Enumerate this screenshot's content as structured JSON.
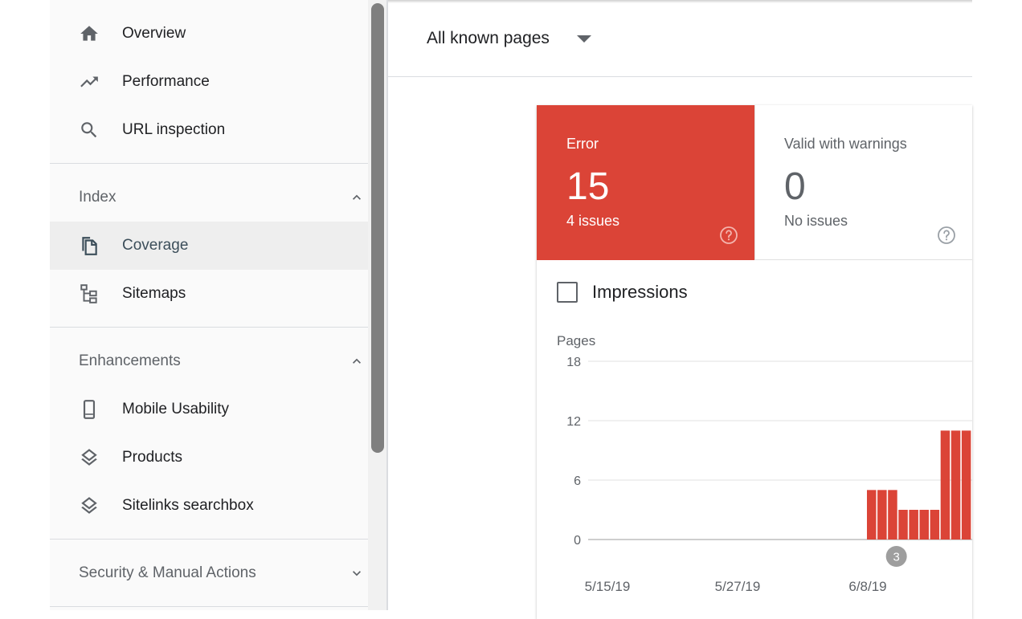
{
  "sidebar": {
    "top_items": [
      {
        "label": "Overview",
        "icon": "home-icon"
      },
      {
        "label": "Performance",
        "icon": "trending-up-icon"
      },
      {
        "label": "URL inspection",
        "icon": "search-icon"
      }
    ],
    "index_section": {
      "label": "Index",
      "expanded": true,
      "items": [
        {
          "label": "Coverage",
          "icon": "coverage-icon",
          "active": true
        },
        {
          "label": "Sitemaps",
          "icon": "sitemap-icon"
        }
      ]
    },
    "enhancements_section": {
      "label": "Enhancements",
      "expanded": true,
      "items": [
        {
          "label": "Mobile Usability",
          "icon": "smartphone-icon"
        },
        {
          "label": "Products",
          "icon": "layers-icon"
        },
        {
          "label": "Sitelinks searchbox",
          "icon": "layers-icon"
        }
      ]
    },
    "security_section": {
      "label": "Security & Manual Actions",
      "expanded": false
    }
  },
  "main": {
    "filter": {
      "label": "All known pages"
    },
    "tiles": {
      "error": {
        "title": "Error",
        "value": "15",
        "sub": "4 issues",
        "color": "#db4437"
      },
      "warnings": {
        "title": "Valid with warnings",
        "value": "0",
        "sub": "No issues"
      }
    },
    "impressions_label": "Impressions",
    "impressions_checked": false
  },
  "chart_data": {
    "type": "bar",
    "ylabel": "Pages",
    "ylim": [
      0,
      18
    ],
    "yticks": [
      "18",
      "12",
      "6",
      "0"
    ],
    "xticks": [
      "5/15/19",
      "5/27/19",
      "6/8/19"
    ],
    "bar_color": "#db4437",
    "values": [
      5,
      5,
      5,
      3,
      3,
      3,
      3,
      11,
      11,
      11
    ],
    "annotation": {
      "label": "3"
    }
  }
}
